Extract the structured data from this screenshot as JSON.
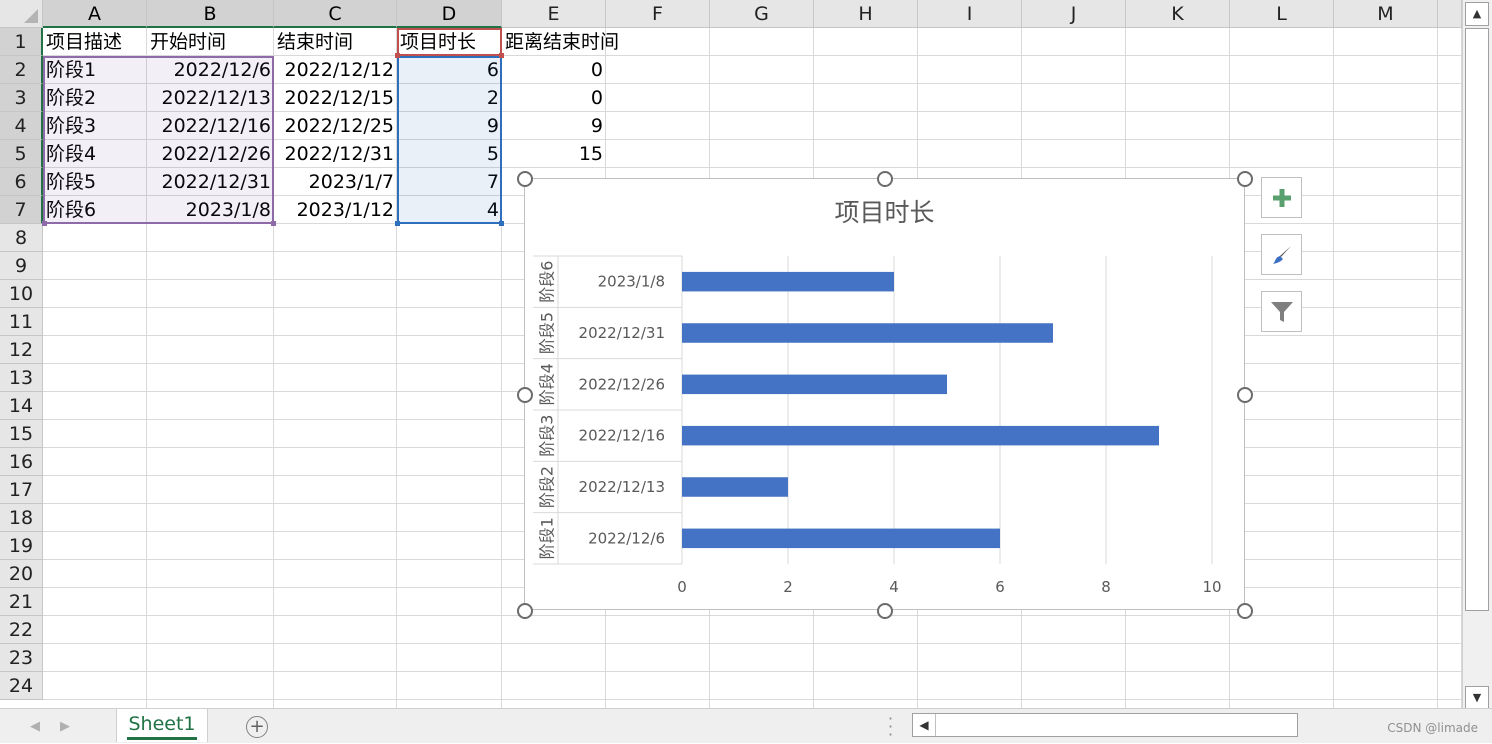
{
  "columns": [
    "A",
    "B",
    "C",
    "D",
    "E",
    "F",
    "G",
    "H",
    "I",
    "J",
    "K",
    "L",
    "M"
  ],
  "rows": [
    "1",
    "2",
    "3",
    "4",
    "5",
    "6",
    "7",
    "8",
    "9",
    "10",
    "11",
    "12",
    "13",
    "14",
    "15",
    "16",
    "17",
    "18",
    "19",
    "20",
    "21",
    "22",
    "23",
    "24"
  ],
  "table": {
    "headers": [
      "项目描述",
      "开始时间",
      "结束时间",
      "项目时长",
      "距离结束时间"
    ],
    "data": [
      [
        "阶段1",
        "2022/12/6",
        "2022/12/12",
        "6",
        "0"
      ],
      [
        "阶段2",
        "2022/12/13",
        "2022/12/15",
        "2",
        "0"
      ],
      [
        "阶段3",
        "2022/12/16",
        "2022/12/25",
        "9",
        "9"
      ],
      [
        "阶段4",
        "2022/12/26",
        "2022/12/31",
        "5",
        "15"
      ],
      [
        "阶段5",
        "2022/12/31",
        "2023/1/7",
        "7",
        ""
      ],
      [
        "阶段6",
        "2023/1/8",
        "2023/1/12",
        "4",
        ""
      ]
    ]
  },
  "chart_data": {
    "type": "bar",
    "orientation": "horizontal",
    "title": "项目时长",
    "categories": [
      {
        "group": "阶段1",
        "label": "2022/12/6"
      },
      {
        "group": "阶段2",
        "label": "2022/12/13"
      },
      {
        "group": "阶段3",
        "label": "2022/12/16"
      },
      {
        "group": "阶段4",
        "label": "2022/12/26"
      },
      {
        "group": "阶段5",
        "label": "2022/12/31"
      },
      {
        "group": "阶段6",
        "label": "2023/1/8"
      }
    ],
    "values": [
      6,
      2,
      9,
      5,
      7,
      4
    ],
    "xlim": [
      0,
      10
    ],
    "xticks": [
      "0",
      "2",
      "4",
      "6",
      "8",
      "10"
    ],
    "grid": true,
    "bar_color": "#4472c4"
  },
  "chart_tools": {
    "add_icon": "plus-icon",
    "style_icon": "brush-icon",
    "filter_icon": "funnel-icon"
  },
  "sheets": {
    "active": "Sheet1"
  },
  "watermark": "CSDN @limade",
  "colors": {
    "accent": "#217346",
    "selection_purple": "#7e4d9e",
    "selection_red": "#c0504d",
    "selection_blue": "#2e6fbd"
  }
}
